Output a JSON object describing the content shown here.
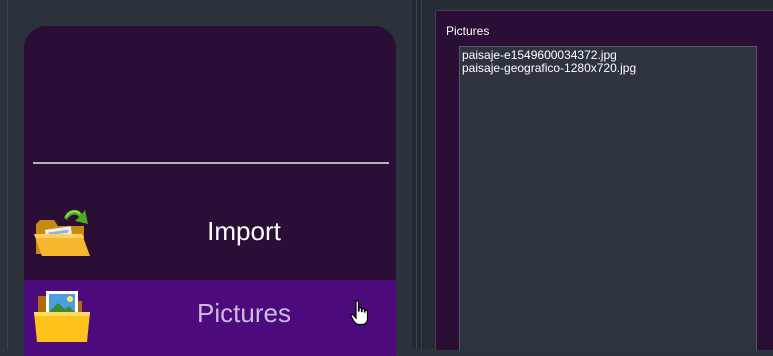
{
  "navigation": {
    "items": [
      {
        "label": "Import",
        "icon": "folder-import-icon"
      },
      {
        "label": "Pictures",
        "icon": "folder-pictures-icon",
        "selected": true
      }
    ]
  },
  "pictures_group": {
    "title": "Pictures",
    "files": [
      "paisaje-e1549600034372.jpg",
      "paisaje-geografico-1280x720.jpg"
    ]
  },
  "colors": {
    "nav_background": "#2b0e36",
    "nav_selected": "#4d0a7c",
    "list_background": "#2e343f"
  }
}
